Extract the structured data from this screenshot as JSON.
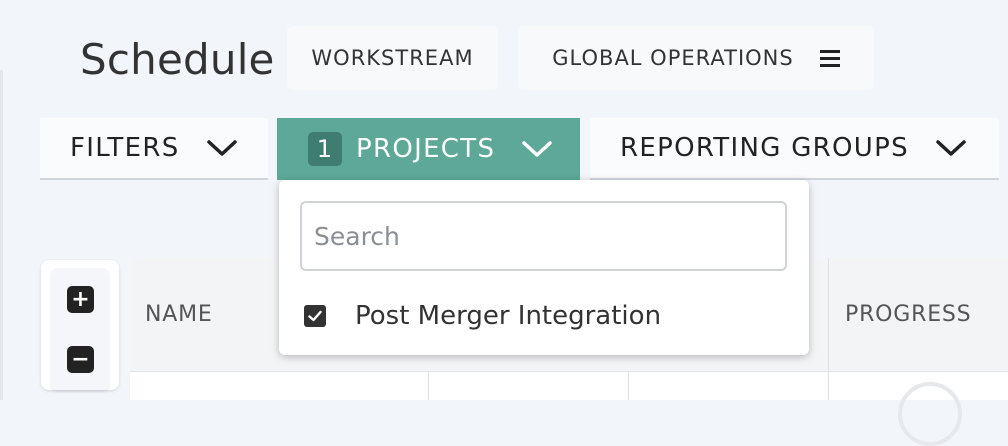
{
  "header": {
    "title": "Schedule",
    "workstream_label": "WORKSTREAM",
    "global_operations_label": "GLOBAL OPERATIONS"
  },
  "filter_bar": {
    "filters_label": "FILTERS",
    "projects_label": "PROJECTS",
    "projects_count": "1",
    "reporting_groups_label": "REPORTING GROUPS"
  },
  "projects_dropdown": {
    "search_placeholder": "Search",
    "search_value": "",
    "options": [
      {
        "label": "Post Merger Integration",
        "checked": true
      }
    ]
  },
  "zoom": {
    "plus_symbol": "+",
    "minus_symbol": "−"
  },
  "table": {
    "columns": [
      "NAME",
      "PROGRESS"
    ]
  },
  "colors": {
    "accent": "#5da896",
    "accent_dark": "#3f7d70",
    "background": "#f2f5fa"
  },
  "icons": {
    "menu": "hamburger-menu-icon",
    "chevron": "chevron-down-icon",
    "check": "checkmark-icon",
    "zoom_in": "plus-icon",
    "zoom_out": "minus-icon"
  }
}
